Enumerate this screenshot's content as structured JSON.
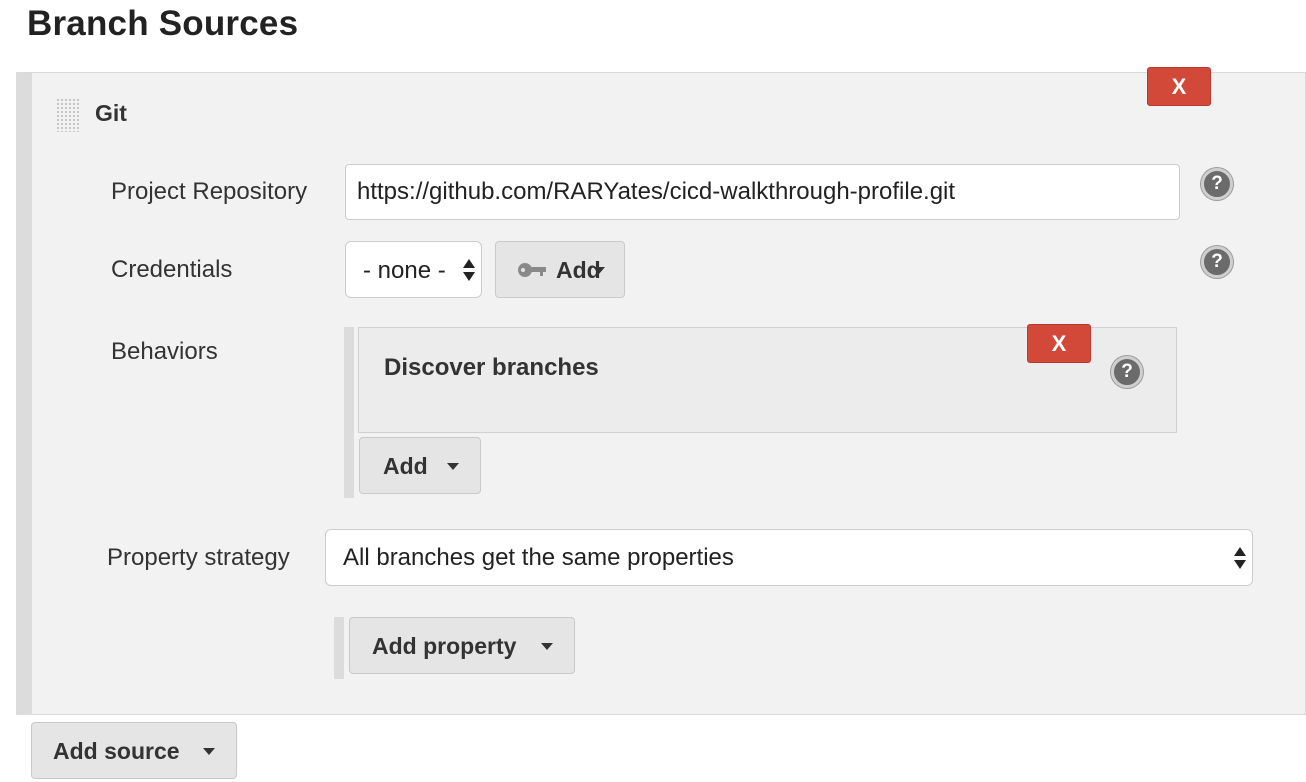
{
  "page": {
    "section_title": "Branch Sources"
  },
  "git_source": {
    "title": "Git",
    "delete_label": "X",
    "project_repository": {
      "label": "Project Repository",
      "value": "https://github.com/RARYates/cicd-walkthrough-profile.git",
      "help": "?"
    },
    "credentials": {
      "label": "Credentials",
      "selected": "- none -",
      "add_label": "Add",
      "help": "?"
    },
    "behaviors": {
      "label": "Behaviors",
      "items": [
        {
          "title": "Discover branches",
          "delete_label": "X",
          "help": "?"
        }
      ],
      "add_label": "Add"
    },
    "property_strategy": {
      "label": "Property strategy",
      "selected": "All branches get the same properties"
    },
    "add_property_label": "Add property"
  },
  "add_source_label": "Add source",
  "icons": {
    "drag_handle": "drag-handle-icon",
    "help": "help-icon",
    "key": "key-icon",
    "dropdown_caret": "chevron-down-icon",
    "select_arrows": "select-updown-icon"
  },
  "colors": {
    "delete_button": "#d24939",
    "panel_background": "#f2f2f2",
    "button_background": "#e5e5e5"
  }
}
